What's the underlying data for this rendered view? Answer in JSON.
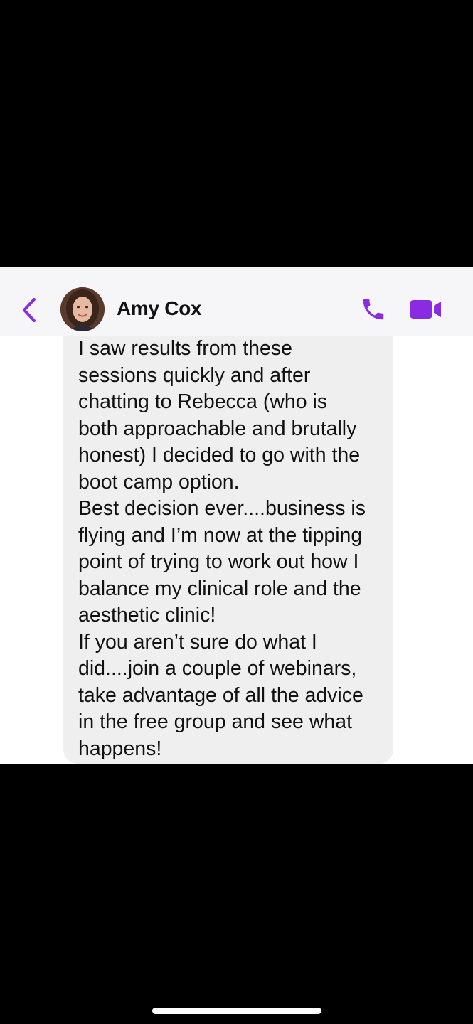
{
  "chat": {
    "contact_name": "Amy Cox",
    "accent_color": "#8a2be2",
    "icons": {
      "back": "chevron-left-icon",
      "call": "phone-icon",
      "video": "video-camera-icon"
    }
  },
  "message": {
    "lines": [
      "I saw results from these",
      "sessions quickly and after",
      "chatting to Rebecca (who is",
      "both approachable and brutally",
      "honest) I decided to go with the",
      "boot camp option.",
      "Best decision ever....business is",
      "flying and I’m now at the tipping",
      "point of trying to work out how I",
      "balance my clinical role and the",
      "aesthetic clinic!",
      "If you aren’t sure do what I",
      "did....join a couple of webinars,",
      "take advantage of all the advice",
      "in the free group and see what",
      "happens!"
    ]
  }
}
